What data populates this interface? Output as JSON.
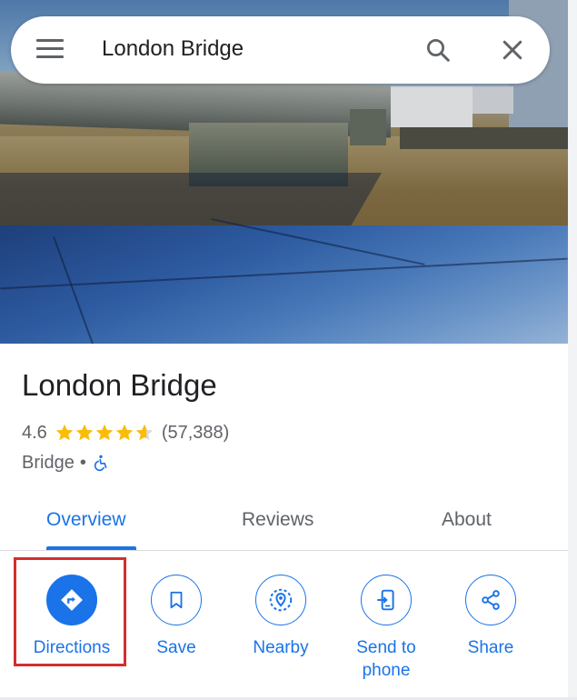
{
  "search": {
    "query": "London Bridge"
  },
  "place": {
    "name": "London Bridge",
    "rating": "4.6",
    "review_count": "(57,388)",
    "stars_value": 4.6,
    "category": "Bridge",
    "separator": "•"
  },
  "tabs": [
    {
      "label": "Overview",
      "active": true
    },
    {
      "label": "Reviews",
      "active": false
    },
    {
      "label": "About",
      "active": false
    }
  ],
  "actions": [
    {
      "label": "Directions",
      "icon": "directions-icon",
      "primary": true
    },
    {
      "label": "Save",
      "icon": "bookmark-icon",
      "primary": false
    },
    {
      "label": "Nearby",
      "icon": "nearby-icon",
      "primary": false
    },
    {
      "label": "Send to phone",
      "icon": "send-to-phone-icon",
      "primary": false
    },
    {
      "label": "Share",
      "icon": "share-icon",
      "primary": false
    }
  ],
  "colors": {
    "accent": "#1a73e8",
    "star": "#fbbc04",
    "highlight": "#d32f2f"
  }
}
